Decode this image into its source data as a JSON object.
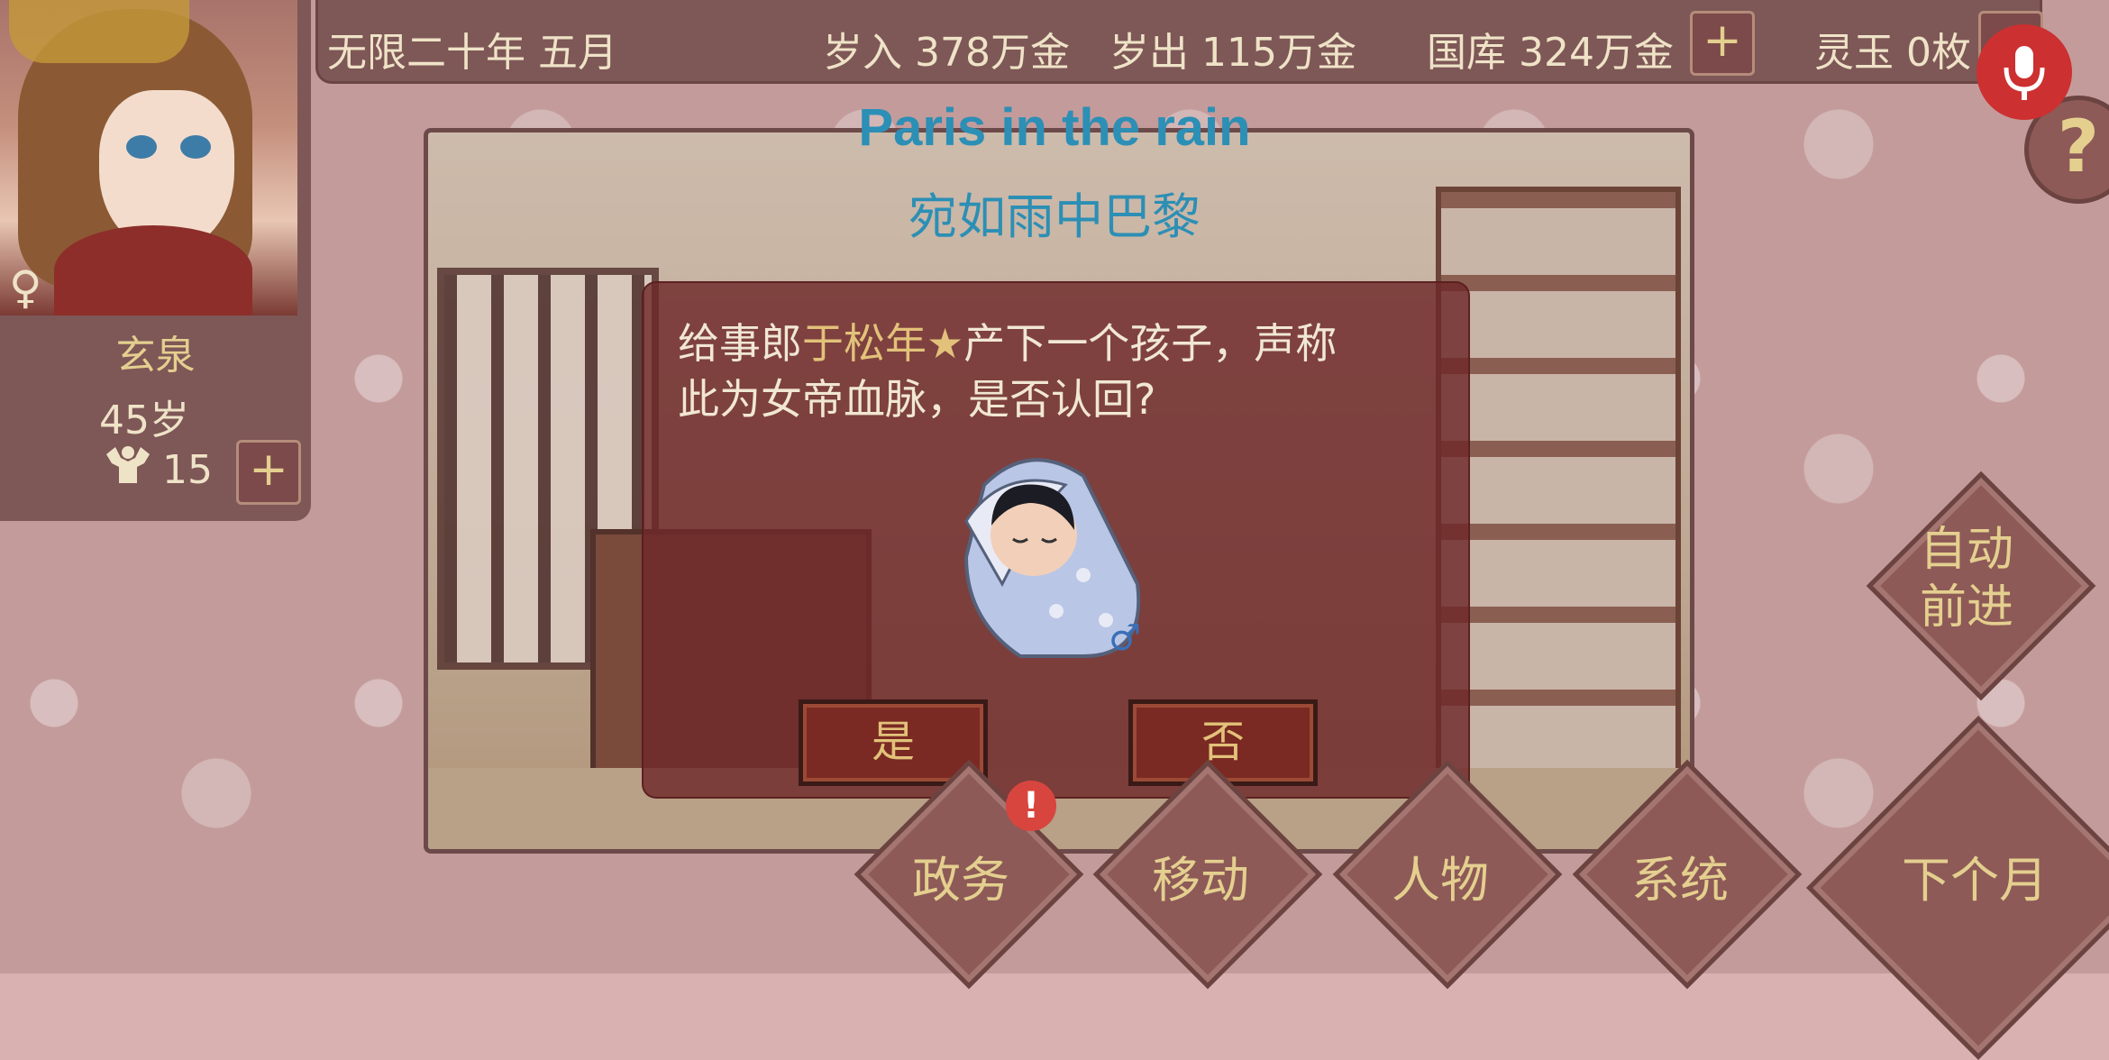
{
  "topbar": {
    "date": "无限二十年 五月",
    "income": "岁入 378万金",
    "expense": "岁出 115万金",
    "treasury": "国库 324万金",
    "jade": "灵玉 0枚",
    "plus": "+"
  },
  "character": {
    "name": "玄泉",
    "age": "45岁",
    "strength": "15",
    "gender_symbol": "♀",
    "plus": "+"
  },
  "song": {
    "title_en": "Paris in the rain",
    "title_zh": "宛如雨中巴黎"
  },
  "dialog": {
    "prefix": "给事郎",
    "name": "于松年",
    "star": "★",
    "line1_rest": "产下一个孩子，声称",
    "line2": "此为女帝血脉，是否认回?",
    "yes": "是",
    "no": "否",
    "baby_gender": "♂"
  },
  "auto_advance": {
    "line1": "自动",
    "line2": "前进"
  },
  "menu": {
    "affairs": "政务",
    "move": "移动",
    "people": "人物",
    "system": "系统",
    "next_month": "下个月"
  },
  "badge": "!",
  "help": "?",
  "colors": {
    "gold": "#e4cf8f",
    "song_blue": "#2c8fb5",
    "dialog_bg": "#6e282a",
    "diamond": "#8d5a57"
  }
}
